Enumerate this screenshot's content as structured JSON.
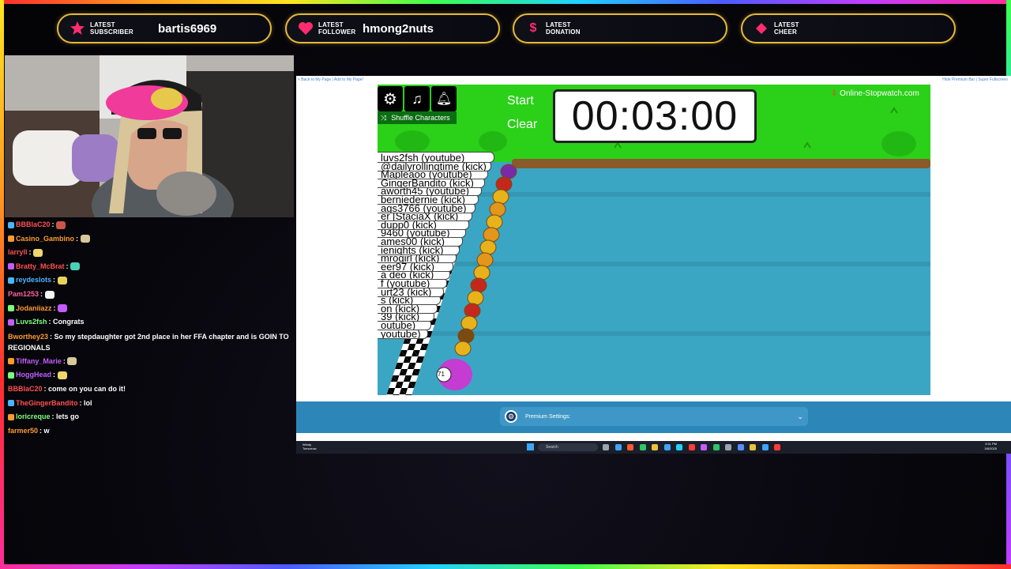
{
  "alerts": {
    "subscriber": {
      "label": "LATEST SUBSCRIBER",
      "label_l1": "LATEST",
      "label_l2": "SUBSCRIBER",
      "value": "bartis6969",
      "icon": "star-icon",
      "color": "#ff2d6f"
    },
    "follower": {
      "label_l1": "LATEST",
      "label_l2": "FOLLOWER",
      "value": "hmong2nuts",
      "icon": "heart-icon",
      "color": "#ff2d6f"
    },
    "donation": {
      "label_l1": "LATEST",
      "label_l2": "DONATION",
      "value": "",
      "icon": "dollar-icon",
      "color": "#ff2d6f"
    },
    "cheer": {
      "label_l1": "LATEST",
      "label_l2": "CHEER",
      "value": "",
      "icon": "diamond-icon",
      "color": "#ff2d6f"
    }
  },
  "chat": [
    {
      "user": "BBBlaC20",
      "text": "",
      "color": "#ff5050",
      "emote": true
    },
    {
      "user": "Casino_Gambino",
      "text": "",
      "color": "#ff9a2d",
      "emote": true
    },
    {
      "user": "larryll",
      "text": "",
      "color": "#ff5050",
      "emote": true
    },
    {
      "user": "Bratty_McBrat",
      "text": "",
      "color": "#ff5050",
      "emote": true
    },
    {
      "user": "reydeslots",
      "text": "",
      "color": "#4ab6ff",
      "emote": true
    },
    {
      "user": "Pam1253",
      "text": "",
      "color": "#ff5fa2",
      "emote": true
    },
    {
      "user": "Jodaniiazz",
      "text": "",
      "color": "#ff9a2d",
      "emote": true
    },
    {
      "user": "Luvs2fsh",
      "text": "Congrats",
      "color": "#7dff7d",
      "emote": false
    },
    {
      "user": "Bworthey23",
      "text": "So my stepdaughter got 2nd place in her FFA chapter and is GOIN TO REGIONALS",
      "color": "#ff9a2d",
      "emote": false
    },
    {
      "user": "Tiffany_Marie",
      "text": "",
      "color": "#c45cff",
      "emote": true
    },
    {
      "user": "HoggHead",
      "text": "",
      "color": "#c45cff",
      "emote": true
    },
    {
      "user": "BBBlaC20",
      "text": "come on you can do it!",
      "color": "#ff5050",
      "emote": false
    },
    {
      "user": "TheGingerBandito",
      "text": "lol",
      "color": "#ff5050",
      "emote": false
    },
    {
      "user": "loricreque",
      "text": "lets go",
      "color": "#7dff7d",
      "emote": false
    },
    {
      "user": "farmer50",
      "text": "w",
      "color": "#ff9a2d",
      "emote": false
    }
  ],
  "screen": {
    "top_left_links": "< Back to My Page | Add to My Page!",
    "top_right_links": "Hide Premium Bar | Super Fullscreen",
    "race": {
      "shuffle_label": "Shuffle Characters",
      "start_label": "Start",
      "clear_label": "Clear",
      "timer": "00:03:00",
      "brand": "Online-Stopwatch.com",
      "racers": [
        "luvs2fsh (youtube)",
        "@dailyrollingtime (kick)",
        "Mapleaoo (youtube)",
        "GingerBandito (kick)",
        "aworth45 (youtube)",
        "berniedernie (kick)",
        "ags3766 (youtube)",
        "er [StaciaX (kick)",
        "dupp0 (kick)",
        "9460 (youtube)",
        "ames00 (kick)",
        "ieniqhts (kick)",
        "mrogirl (kick)",
        "eer97 (kick)",
        "a deo (kick)",
        "f (youtube)",
        "urt23 (kick)",
        "s (kick)",
        "on (kick)",
        "39 (kick)",
        "outube)",
        "youtube)"
      ],
      "lead_duck_number": "71"
    },
    "premium_settings_label": "Premium Settings:"
  },
  "taskbar": {
    "weather_label": "Windy",
    "weather_sub": "Tomorrow",
    "search_placeholder": "Search",
    "time": "3:31 PM",
    "date": "3/6/2025"
  }
}
